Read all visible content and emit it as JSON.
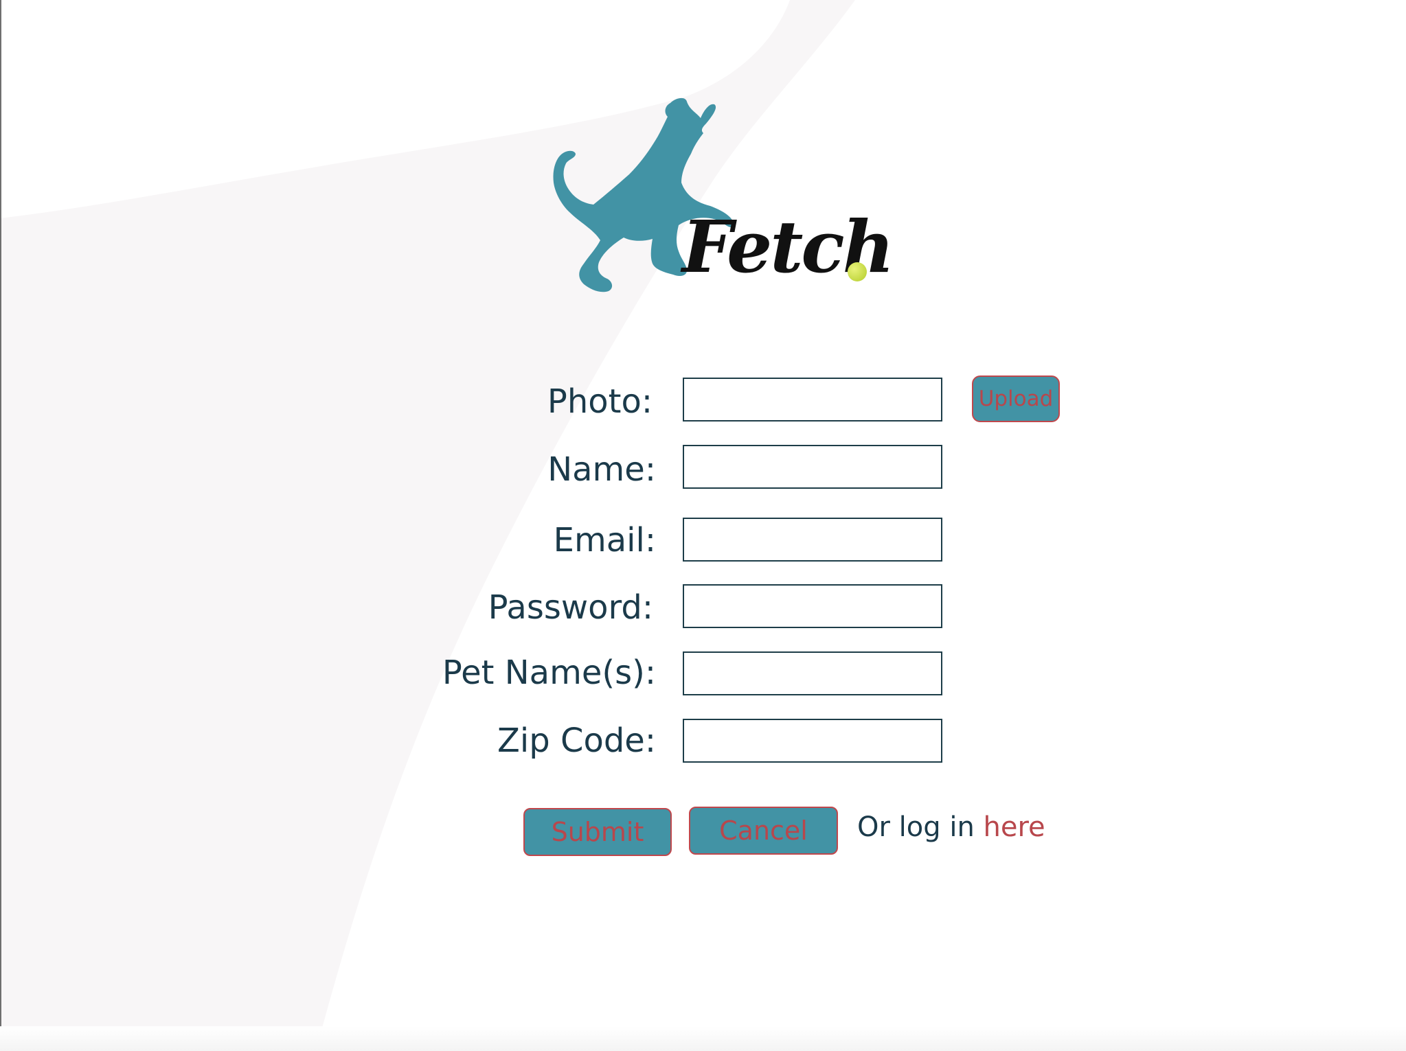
{
  "app": {
    "brand_name": "Fetch"
  },
  "colors": {
    "accent_teal": "#4293a5",
    "accent_red": "#b8474c",
    "text_dark": "#1b3a4a",
    "ball_green": "#c9dc3f"
  },
  "icons": {
    "logo": "dog-silhouette-icon",
    "ball": "tennis-ball-icon"
  },
  "form": {
    "photo": {
      "label": "Photo:",
      "value": "",
      "placeholder": ""
    },
    "upload_label": "Upload",
    "name": {
      "label": "Name:",
      "value": "",
      "placeholder": ""
    },
    "email": {
      "label": "Email:",
      "value": "",
      "placeholder": ""
    },
    "password": {
      "label": "Password:",
      "value": "",
      "placeholder": ""
    },
    "pet_names": {
      "label": "Pet Name(s):",
      "value": "",
      "placeholder": ""
    },
    "zip_code": {
      "label": "Zip Code:",
      "value": "",
      "placeholder": ""
    },
    "submit_label": "Submit",
    "cancel_label": "Cancel",
    "login_prefix": "Or log in ",
    "login_link": "here"
  }
}
